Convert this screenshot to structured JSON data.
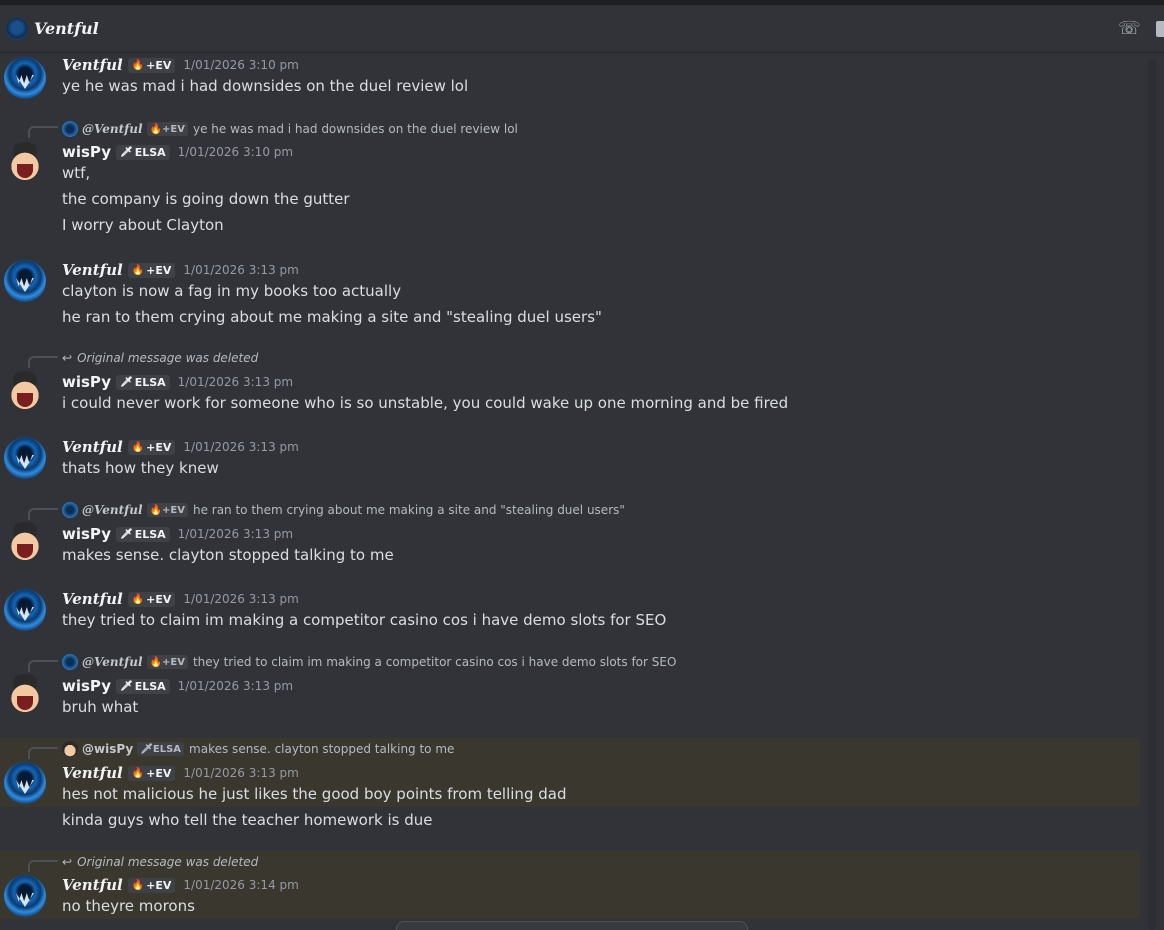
{
  "channel": {
    "title": "Ventful",
    "icons": {
      "call": "phone-call-icon"
    }
  },
  "users": {
    "ventful": {
      "name": "Ventful",
      "tag_icon": "🔥",
      "tag": "+EV",
      "avatar": "shark-avatar"
    },
    "wispy": {
      "name": "wisPy",
      "tag_icon": "🗡",
      "tag": "ELSA",
      "avatar": "face-avatar"
    }
  },
  "reply_icons": {
    "deleted_arrow": "↩"
  },
  "messages": [
    {
      "author": "Ventful",
      "tag_icon": "🔥",
      "tag": "+EV",
      "timestamp": "1/01/2026 3:10 pm",
      "lines": [
        "ye he was mad i had downsides on the duel review lol"
      ]
    },
    {
      "reply": {
        "name": "@Ventful",
        "tag_icon": "🔥",
        "tag": "+EV",
        "text": "ye he was mad i had downsides on the duel review lol"
      },
      "author": "wisPy",
      "tag_icon": "🗡",
      "tag": "ELSA",
      "timestamp": "1/01/2026 3:10 pm",
      "lines": [
        "wtf,",
        "the company is going down the gutter",
        "I worry about Clayton"
      ]
    },
    {
      "author": "Ventful",
      "tag_icon": "🔥",
      "tag": "+EV",
      "timestamp": "1/01/2026 3:13 pm",
      "lines": [
        "clayton is now a fag in my books too actually",
        "he ran to them crying about me making a site and \"stealing duel users\""
      ]
    },
    {
      "reply": {
        "deleted": "Original message was deleted"
      },
      "author": "wisPy",
      "tag_icon": "🗡",
      "tag": "ELSA",
      "timestamp": "1/01/2026 3:13 pm",
      "lines": [
        "i could never work for someone who is so unstable, you could wake up one morning and be fired"
      ]
    },
    {
      "author": "Ventful",
      "tag_icon": "🔥",
      "tag": "+EV",
      "timestamp": "1/01/2026 3:13 pm",
      "lines": [
        "thats how they knew"
      ]
    },
    {
      "reply": {
        "name": "@Ventful",
        "tag_icon": "🔥",
        "tag": "+EV",
        "text": "he ran to them crying about me making a site and \"stealing duel users\""
      },
      "author": "wisPy",
      "tag_icon": "🗡",
      "tag": "ELSA",
      "timestamp": "1/01/2026 3:13 pm",
      "lines": [
        "makes sense. clayton stopped talking to me"
      ]
    },
    {
      "author": "Ventful",
      "tag_icon": "🔥",
      "tag": "+EV",
      "timestamp": "1/01/2026 3:13 pm",
      "lines": [
        "they tried to claim im making a competitor casino cos i have demo slots for SEO"
      ]
    },
    {
      "reply": {
        "name": "@Ventful",
        "tag_icon": "🔥",
        "tag": "+EV",
        "text": "they tried to claim im making a competitor casino cos i have demo slots for SEO"
      },
      "author": "wisPy",
      "tag_icon": "🗡",
      "tag": "ELSA",
      "timestamp": "1/01/2026 3:13 pm",
      "lines": [
        "bruh what"
      ]
    },
    {
      "reply": {
        "name": "@wisPy",
        "tag_icon": "🗡",
        "tag": "ELSA",
        "text": "makes sense. clayton stopped talking to me"
      },
      "author": "Ventful",
      "tag_icon": "🔥",
      "tag": "+EV",
      "timestamp": "1/01/2026 3:13 pm",
      "lines": [
        "hes not malicious he just likes the good boy points from telling dad",
        "kinda guys who tell the teacher homework is due"
      ]
    },
    {
      "reply": {
        "deleted": "Original message was deleted"
      },
      "author": "Ventful",
      "tag_icon": "🔥",
      "tag": "+EV",
      "timestamp": "1/01/2026 3:14 pm",
      "lines": [
        "no theyre morons"
      ]
    }
  ]
}
